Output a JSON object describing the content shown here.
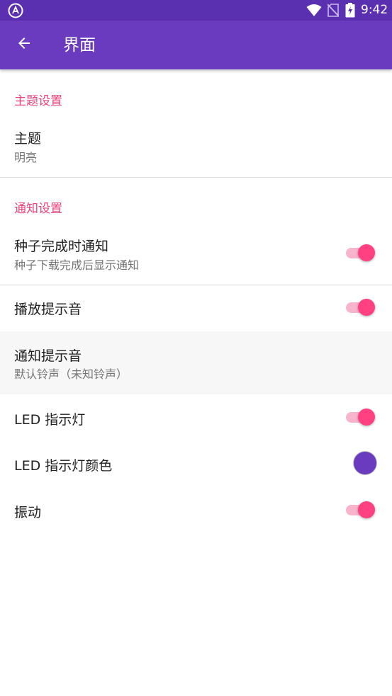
{
  "status_bar": {
    "time": "9:42",
    "icons": [
      "app-notification-icon",
      "wifi-icon",
      "no-sim-icon",
      "battery-charging-icon"
    ]
  },
  "app_bar": {
    "back_icon": "arrow-left-icon",
    "title": "界面"
  },
  "sections": {
    "theme": {
      "header": "主题设置",
      "theme_pref": {
        "title": "主题",
        "summary": "明亮"
      }
    },
    "notifications": {
      "header": "通知设置",
      "torrent_done": {
        "title": "种子完成时通知",
        "summary": "种子下载完成后显示通知",
        "enabled": true
      },
      "play_sound": {
        "title": "播放提示音",
        "enabled": true
      },
      "notification_sound": {
        "title": "通知提示音",
        "summary": "默认铃声（未知铃声）"
      },
      "led": {
        "title": "LED 指示灯",
        "enabled": true
      },
      "led_color": {
        "title": "LED 指示灯颜色",
        "color": "#6a3bbf"
      },
      "vibrate": {
        "title": "振动",
        "enabled": true
      }
    }
  },
  "colors": {
    "status_bar": "#5a2fb0",
    "app_bar": "#6a3bbf",
    "accent": "#e8407a",
    "switch_thumb": "#ff4081",
    "switch_track": "#f8b4cc",
    "pressed_row": "#f7f7f7"
  }
}
